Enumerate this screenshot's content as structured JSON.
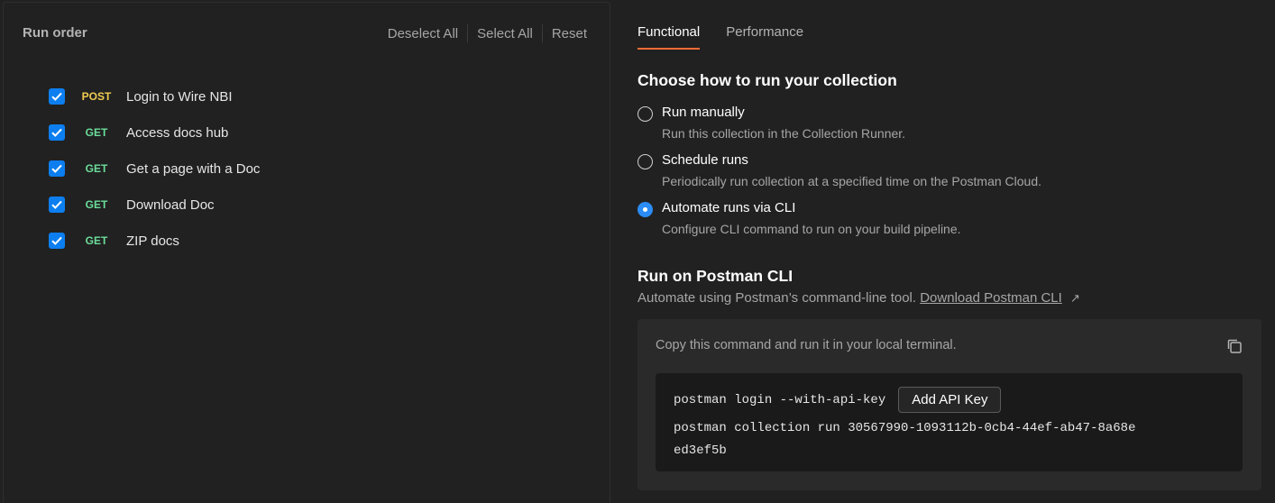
{
  "run_order": {
    "title": "Run order",
    "actions": [
      "Deselect All",
      "Select All",
      "Reset"
    ],
    "requests": [
      {
        "method": "POST",
        "name": "Login to Wire NBI",
        "checked": true
      },
      {
        "method": "GET",
        "name": "Access docs hub",
        "checked": true
      },
      {
        "method": "GET",
        "name": "Get a page with a Doc",
        "checked": true
      },
      {
        "method": "GET",
        "name": "Download Doc",
        "checked": true
      },
      {
        "method": "GET",
        "name": "ZIP docs",
        "checked": true
      }
    ]
  },
  "tabs": [
    {
      "label": "Functional",
      "active": true
    },
    {
      "label": "Performance",
      "active": false
    }
  ],
  "choose": {
    "title": "Choose how to run your collection",
    "options": [
      {
        "label": "Run manually",
        "desc": "Run this collection in the Collection Runner.",
        "selected": false
      },
      {
        "label": "Schedule runs",
        "desc": "Periodically run collection at a specified time on the Postman Cloud.",
        "selected": false
      },
      {
        "label": "Automate runs via CLI",
        "desc": "Configure CLI command to run on your build pipeline.",
        "selected": true
      }
    ]
  },
  "cli": {
    "title": "Run on Postman CLI",
    "subtitle": "Automate using Postman’s command-line tool.",
    "download_link": "Download Postman CLI",
    "hint": "Copy this command and run it in your local terminal.",
    "command1": "postman login --with-api-key",
    "api_key_button": "Add API Key",
    "command2": "postman collection run 30567990-1093112b-0cb4-44ef-ab47-8a68eed3ef5b"
  },
  "colors": {
    "accent": "#ff6c37",
    "checkbox": "#0c7ef0",
    "post": "#f0cc51",
    "get": "#6bdd9a"
  }
}
